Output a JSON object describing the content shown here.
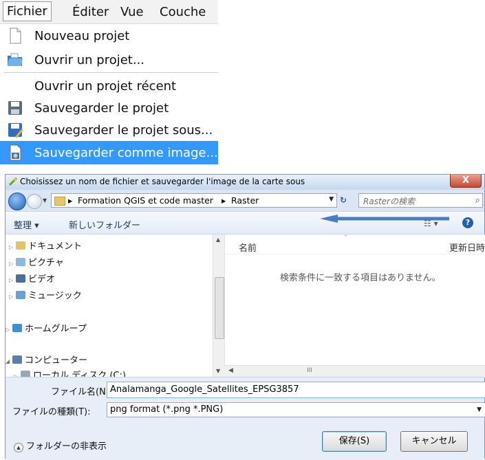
{
  "menu": {
    "bar": [
      "Fichier",
      "Éditer",
      "Vue",
      "Couche"
    ],
    "items": [
      {
        "label": "Nouveau projet",
        "icon": "new-document-icon"
      },
      {
        "label": "Ouvrir un projet...",
        "icon": "open-folder-icon"
      },
      {
        "label": "Ouvrir un projet récent",
        "icon": ""
      },
      {
        "label": "Sauvegarder le projet",
        "icon": "floppy-disk-icon"
      },
      {
        "label": "Sauvegarder le projet sous...",
        "icon": "save-as-icon"
      },
      {
        "label": "Sauvegarder comme image...",
        "icon": "save-image-icon",
        "selected": true
      }
    ],
    "selected_color": "#3399ff"
  },
  "dialog": {
    "title": "Choisissez un nom de fichier et sauvegarder l'image de la carte sous",
    "close": "X",
    "breadcrumb": [
      "Formation QGIS et code master",
      "Raster"
    ],
    "search_placeholder": "Rasterの検索",
    "toolbar": {
      "organize": "整理 ▾",
      "new_folder": "新しいフォルダー",
      "views": "☷ ▾",
      "help": "?"
    },
    "nav_tree": [
      "ドキュメント",
      "ピクチャ",
      "ビデオ",
      "ミュージック",
      "ホームグループ",
      "コンピューター",
      "ローカル ディスク (C:)"
    ],
    "columns": {
      "name": "名前",
      "date": "更新日時"
    },
    "empty_message": "検索条件に一致する項目はありません。",
    "filename_label": "ファイル名(N):",
    "filename_value": "Analamanga_Google_Satellites_EPSG3857",
    "filetype_label": "ファイルの種類(T):",
    "filetype_value": "png format (*.png *.PNG)",
    "hide_folders": "フォルダーの非表示",
    "save": "保存(S)",
    "cancel": "キャンセル",
    "annotation_arrow_color": "#4a7cc0"
  }
}
